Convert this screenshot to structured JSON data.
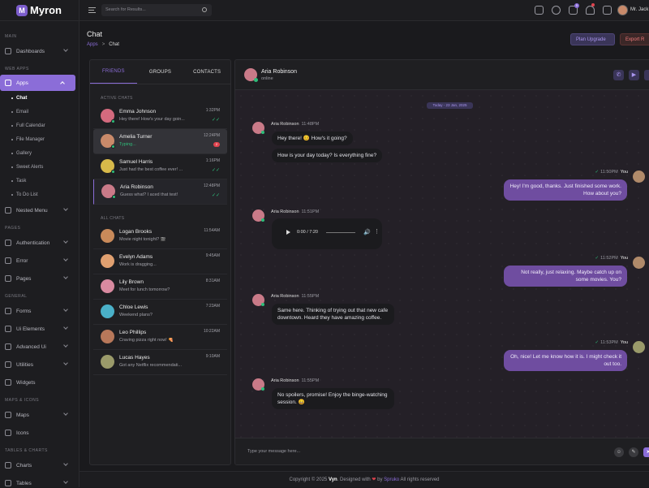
{
  "app": {
    "name": "Myron",
    "logo_letter": "M"
  },
  "topbar": {
    "search_placeholder": "Search for Results...",
    "user_name": "Mr. Jack",
    "cart_count": "5"
  },
  "sidebar": {
    "cat_main": "MAIN",
    "cat_web_apps": "WEB APPS",
    "cat_pages": "PAGES",
    "cat_general": "GENERAL",
    "cat_maps": "MAPS & ICONS",
    "cat_tables": "TABLES & CHARTS",
    "dashboards": "Dashboards",
    "apps": "Apps",
    "sub_chat": "Chat",
    "sub_email": "Email",
    "sub_calendar": "Full Calendar",
    "sub_files": "File Manager",
    "sub_gallery": "Gallery",
    "sub_alerts": "Sweet Alerts",
    "sub_task": "Task",
    "sub_todo": "To Do List",
    "nested": "Nested Menu",
    "auth": "Authentication",
    "error": "Error",
    "pages": "Pages",
    "forms": "Forms",
    "ui": "Ui Elements",
    "advanced": "Advanced Ui",
    "utilities": "Utilities",
    "widgets": "Widgets",
    "maps": "Maps",
    "icons": "Icons",
    "charts": "Charts",
    "tables": "Tables"
  },
  "page": {
    "title": "Chat",
    "crumb_parent": "Apps",
    "crumb_sep": ">",
    "crumb_current": "Chat",
    "btn_upgrade": "Plan Upgrade",
    "btn_export": "Export R"
  },
  "friends": {
    "tab_friends": "FRIENDS",
    "tab_groups": "GROUPS",
    "tab_contacts": "CONTACTS",
    "active_label": "ACTIVE CHATS",
    "all_label": "ALL CHATS",
    "active": [
      {
        "name": "Emma Johnson",
        "msg": "Hey there! How's your day goin...",
        "time": "1:32PM",
        "color": "#d46a7e"
      },
      {
        "name": "Amelia Turner",
        "msg": "Typing...",
        "time": "12:24PM",
        "count": "2",
        "color": "#c98a6a"
      },
      {
        "name": "Samuel Harris",
        "msg": "Just had the best coffee ever! ...",
        "time": "1:16PM",
        "color": "#d7b94a"
      },
      {
        "name": "Aria Robinson",
        "msg": "Guess what? I aced that test!",
        "time": "12:48PM",
        "color": "#c97a88"
      }
    ],
    "all": [
      {
        "name": "Logan Brooks",
        "msg": "Movie night tonight? 🎬",
        "time": "11:54AM",
        "color": "#c98a5a"
      },
      {
        "name": "Evelyn Adams",
        "msg": "Work is dragging...",
        "time": "9:45AM",
        "color": "#e0a070"
      },
      {
        "name": "Lily Brown",
        "msg": "Meet for lunch tomorrow?",
        "time": "8:31AM",
        "color": "#d98aa0"
      },
      {
        "name": "Chloe Lewis",
        "msg": "Weekend plans?",
        "time": "7:23AM",
        "color": "#4ab0c8"
      },
      {
        "name": "Leo Phillips",
        "msg": "Craving pizza right now! 🍕",
        "time": "10:22AM",
        "color": "#b8785a"
      },
      {
        "name": "Lucas Hayes",
        "msg": "Got any Netflix recommendati...",
        "time": "9:10AM",
        "color": "#9a9a6a"
      }
    ]
  },
  "chat": {
    "name": "Aria Robinson",
    "status": "online",
    "date_label": "Today - 23 Jan, 2025",
    "sender": "Aria Robinson",
    "you": "You",
    "m1_time": "11:48PM",
    "m1_b1": "Hey there! 😊 How's it going?",
    "m1_b2": "How is your day today? Is everything fine?",
    "m2_time": "11:50PM",
    "m2_text": "Hey! I'm good, thanks. Just finished some work. How about you?",
    "m3_time": "11:51PM",
    "audio_time": "0:00 / 7:20",
    "m4_time": "11:52PM",
    "m4_text": "Not really, just relaxing. Maybe catch up on some movies. You?",
    "m5_time": "11:55PM",
    "m5_text": "Same here. Thinking of trying out that new cafe downtown. Heard they have amazing coffee.",
    "m6_time": "11:53PM",
    "m6_text": "Oh, nice! Let me know how it is. I might check it out too.",
    "m7_time": "11:55PM",
    "m7_text": "No spoilers, promise! Enjoy the binge-watching session. 😄",
    "composer_placeholder": "Type your message here..."
  },
  "footer": {
    "pre": "Copyright © 2025 ",
    "brand": "Vyn",
    "mid": ". Designed with ",
    "heart": "❤",
    "by": " by ",
    "author": "Spruko",
    "post": " All rights reserved"
  },
  "colors": {
    "accent": "#8b6dd8",
    "online": "#2ebd7a",
    "danger": "#e0434e",
    "bubble_out": "#6f4da0"
  }
}
